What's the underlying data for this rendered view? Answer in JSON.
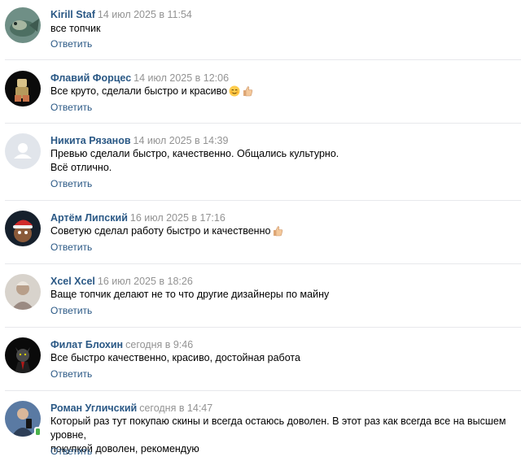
{
  "colors": {
    "author_link": "#2a5885",
    "date": "#939393",
    "divider": "#e7e8ec",
    "reply": "#2a5885"
  },
  "comments": [
    {
      "author": "Kirill Staf",
      "date": "14 июл 2025 в 11:54",
      "lines": [
        "все топчик"
      ],
      "emoji": [],
      "reply": "Ответить",
      "avatar": "fish-photo"
    },
    {
      "author": "Флавий Форцес",
      "date": "14 июл 2025 в 12:06",
      "lines": [
        "Все круто, сделали быстро и красиво"
      ],
      "emoji": [
        "relieved-face-emoji",
        "thumbs-up-emoji"
      ],
      "reply": "Ответить",
      "avatar": "figure-on-black"
    },
    {
      "author": "Никита Рязанов",
      "date": "14 июл 2025 в 14:39",
      "lines": [
        "Превью сделали быстро, качественно. Общались культурно.",
        "Всё отлично."
      ],
      "emoji": [],
      "reply": "Ответить",
      "avatar": "default-user-placeholder"
    },
    {
      "author": "Артём Липский",
      "date": "16 июл 2025 в 17:16",
      "lines": [
        "Советую сделал работу быстро и качественно"
      ],
      "emoji": [
        "thumbs-up-emoji"
      ],
      "reply": "Ответить",
      "avatar": "character-with-santa-hat"
    },
    {
      "author": "Xcel Xcel",
      "date": "16 июл 2025 в 18:26",
      "lines": [
        "Ваще топчик делают не то что другие дизайнеры по майну"
      ],
      "emoji": [],
      "reply": "Ответить",
      "avatar": "person-light-photo"
    },
    {
      "author": "Филат Блохин",
      "date": "сегодня в 9:46",
      "lines": [
        "Все быстро качественно, красиво, достойная работа"
      ],
      "emoji": [],
      "reply": "Ответить",
      "avatar": "cat-in-suit"
    },
    {
      "author": "Роман Угличский",
      "date": "сегодня в 14:47",
      "lines": [
        "Который раз тут покупаю скины и всегда остаюсь доволен. В этот раз как всегда все на высшем уровне,",
        "покупкой доволен, рекомендую"
      ],
      "emoji": [],
      "reply": "Ответить",
      "avatar": "person-with-phone-online"
    }
  ]
}
